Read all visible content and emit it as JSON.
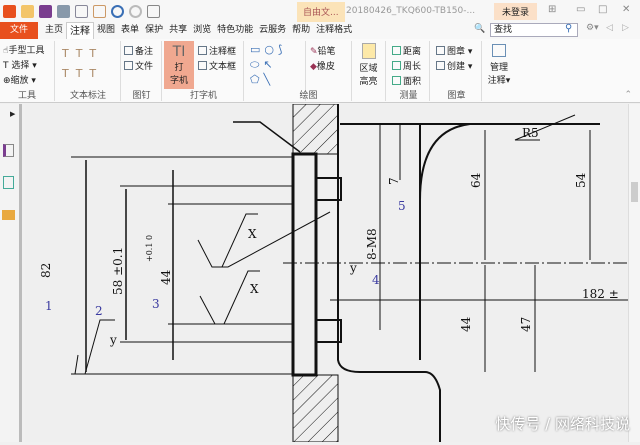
{
  "titlebar": {
    "doc_tab": "自由文...",
    "doc_title": "20180426_TKQ600-TB150-...",
    "login": "未登录"
  },
  "menu": [
    "主页",
    "注释",
    "视图",
    "表单",
    "保护",
    "共享",
    "浏览",
    "特色功能",
    "云服务",
    "帮助",
    "注释格式"
  ],
  "menu_file": "文件",
  "search": {
    "value": "查找"
  },
  "ribbon": {
    "tools": {
      "hand": "手型工具",
      "select": "选择",
      "zoom": "缩放",
      "label": "工具"
    },
    "text_markup": {
      "label": "文本标注"
    },
    "pin": {
      "note": "备注",
      "file": "文件",
      "label": "图钉"
    },
    "typewriter": {
      "big1": "打",
      "big2": "字机",
      "callout": "注释框",
      "textbox": "文本框",
      "label": "打字机"
    },
    "drawing": {
      "pencil": "铅笔",
      "eraser": "橡皮",
      "label": "绘图"
    },
    "area": {
      "l1": "区域",
      "l2": "高亮"
    },
    "measure": {
      "distance": "距离",
      "perimeter": "周长",
      "area": "面积",
      "label": "测量"
    },
    "stamp": {
      "stamp": "图章",
      "create": "创建",
      "label": "图章"
    },
    "manage": {
      "l1": "管理",
      "l2": "注释"
    }
  },
  "drawing": {
    "d82": "82",
    "d58": "58 ±0.1",
    "d44a": "44",
    "tol": "+0.1 0",
    "n1": "1",
    "n2": "2",
    "n3": "3",
    "n4": "4",
    "n5": "5",
    "x1": "X",
    "x2": "X",
    "y1": "y",
    "y2": "y",
    "m8": "8-M8",
    "d7": "7",
    "d64": "64",
    "d54": "54",
    "d44b": "44",
    "d47": "47",
    "d182": "182 ±",
    "r5": "R5"
  },
  "watermark": "快传号 / 网络科技说"
}
